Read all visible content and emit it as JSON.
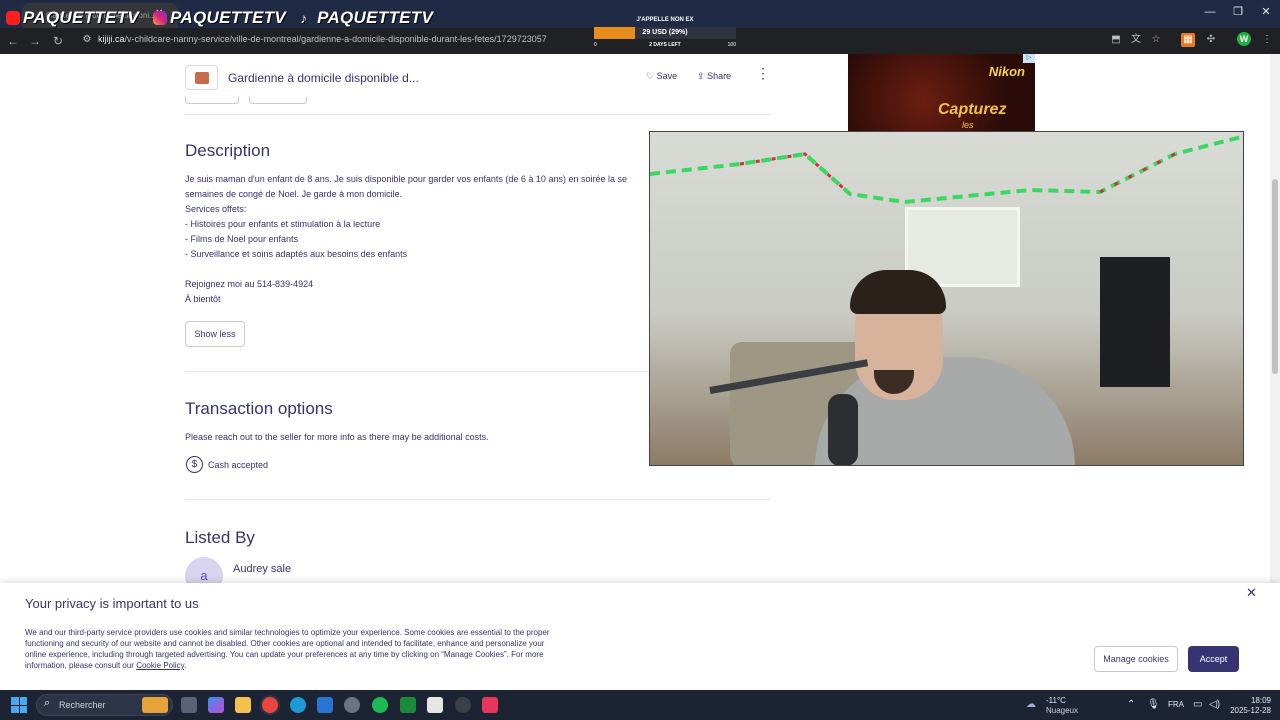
{
  "browser": {
    "tab_title": "Gardienne à domicile disponi...",
    "url_domain": "kijiji.ca",
    "url_path": "/v-childcare-nanny-service/ville-de-montreal/gardienne-a-domicile-disponible-durant-les-fetes/1729723057"
  },
  "overlay": {
    "brands": [
      "PAQUETTETV",
      "PAQUETTETV",
      "PAQUETTETV"
    ],
    "donation": {
      "title": "J'APPELLE NON EX",
      "amount_text": "29 USD (29%)",
      "progress_percent": 29,
      "min": "0",
      "max": "100",
      "days_left": "2 DAYS LEFT"
    }
  },
  "listing": {
    "title": "Gardienne à domicile disponible d...",
    "save_label": "Save",
    "share_label": "Share"
  },
  "ad": {
    "brand": "Nikon",
    "text": "Capturez",
    "text_line2": "les"
  },
  "description": {
    "heading": "Description",
    "lines": [
      "Je suis maman d'un enfant de 8 ans. Je suis disponible pour garder vos enfants (de 6 à 10 ans) en soirée la se",
      "semaines de congé de Noel. Je garde à mon domicile.",
      "Services offets:",
      "- Histoires pour enfants et stimulation à la lecture",
      "- Films de Noel pour enfants",
      "- Surveillance et soins adaptés aux besoins des enfants",
      "Rejoignez moi au 514-839-4924",
      "À bientôt"
    ],
    "show_less_label": "Show less"
  },
  "transaction": {
    "heading": "Transaction options",
    "text": "Please reach out to the seller for more info as there may be additional costs.",
    "cash_label": "Cash accepted"
  },
  "listed_by": {
    "heading": "Listed By",
    "avatar_initial": "a",
    "seller_name": "Audrey sale"
  },
  "privacy": {
    "title": "Your privacy is important to us",
    "body": "We and our third-party service providers use cookies and similar technologies to optimize your experience. Some cookies are essential to the proper functioning and security of our website and cannot be disabled. Other cookies are optional and intended to facilitate, enhance and personalize your online experience, including through targeted advertising. You can update your preferences at any time by clicking on “Manage Cookies”. For more information, please consult our",
    "link_label": "Cookie Policy",
    "link_suffix": ".",
    "manage_label": "Manage cookies",
    "accept_label": "Accept"
  },
  "taskbar": {
    "search_placeholder": "Rechercher",
    "weather_temp": "-11°C",
    "weather_cond": "Nuageux",
    "language": "FRA",
    "time": "18:09",
    "date": "2025-12-28"
  },
  "colors": {
    "text": "#373373",
    "accept_bg": "#373373",
    "donation_fill": "#e88d1c",
    "taskbar_bg": "#1c2434"
  }
}
